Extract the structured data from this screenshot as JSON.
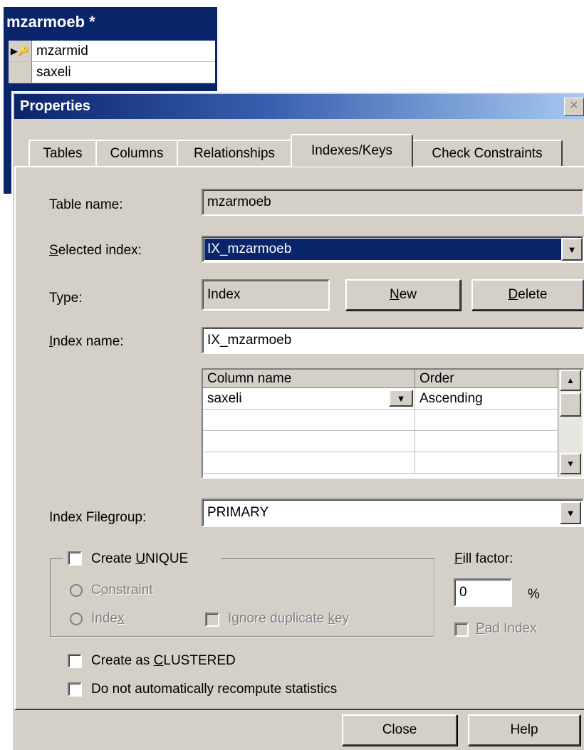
{
  "table_window": {
    "title": "mzarmoeb *",
    "columns": [
      {
        "marker": "▶🔑",
        "name": "mzarmid"
      },
      {
        "marker": "",
        "name": "saxeli"
      }
    ]
  },
  "dialog": {
    "title": "Properties",
    "close_glyph": "✕",
    "tabs": [
      "Tables",
      "Columns",
      "Relationships",
      "Indexes/Keys",
      "Check Constraints"
    ],
    "active_tab": "Indexes/Keys",
    "table_name_label": "Table name:",
    "table_name_value": "mzarmoeb",
    "selected_index_label_u": "S",
    "selected_index_label_rest": "elected index:",
    "selected_index_value": "IX_mzarmoeb",
    "type_label": "Type:",
    "type_value": "Index",
    "new_button_u": "N",
    "new_button_rest": "ew",
    "delete_button_u": "D",
    "delete_button_rest": "elete",
    "index_name_label_u": "I",
    "index_name_label_rest": "ndex name:",
    "index_name_value": "IX_mzarmoeb",
    "columns_grid": {
      "headers": [
        "Column name",
        "Order"
      ],
      "rows": [
        [
          "saxeli",
          "Ascending"
        ],
        [
          "",
          ""
        ],
        [
          "",
          ""
        ],
        [
          "",
          ""
        ]
      ]
    },
    "filegroup_label_a": "Index File",
    "filegroup_label_u": "g",
    "filegroup_label_b": "roup:",
    "filegroup_value": "PRIMARY",
    "create_unique_a": "Create ",
    "create_unique_u": "U",
    "create_unique_b": "NIQUE",
    "constraint_a": "C",
    "constraint_u": "o",
    "constraint_b": "nstraint",
    "index_radio_a": "Inde",
    "index_radio_u": "x",
    "ignore_dup_a": "Ignore duplicate ",
    "ignore_dup_u": "k",
    "ignore_dup_b": "ey",
    "fill_factor_u": "F",
    "fill_factor_rest": "ill factor:",
    "fill_factor_value": "0",
    "percent": "%",
    "pad_index_u": "P",
    "pad_index_rest": "ad Index",
    "clustered_a": "Create as ",
    "clustered_u": "C",
    "clustered_b": "LUSTERED",
    "recompute_label": "Do not automatically recompute statistics",
    "close_button": "Close",
    "help_button": "Help"
  }
}
